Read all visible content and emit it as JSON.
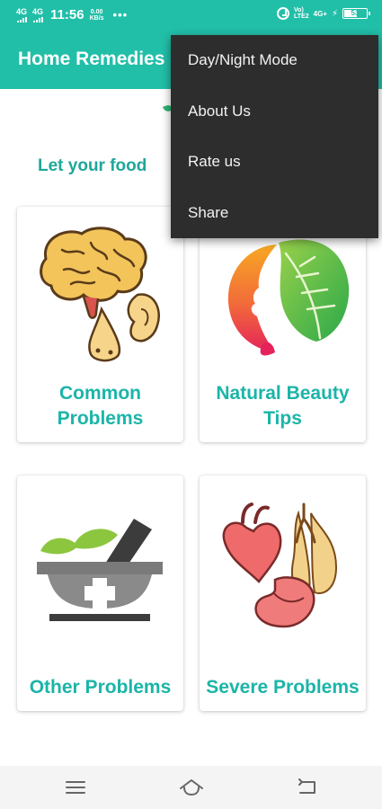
{
  "status_bar": {
    "signal1": "4G",
    "signal2": "4G",
    "time": "11:56",
    "speed_value": "0.00",
    "speed_unit": "KB/s",
    "volte_line1": "Vo)",
    "volte_line2": "LTE2",
    "net_type": "4G+",
    "battery": "53",
    "battery_level": 0.53,
    "icons": [
      "signal-icon",
      "alarm-icon",
      "charging-icon",
      "battery-icon"
    ]
  },
  "app_bar": {
    "title": "Home Remedies",
    "color": "#22bfa8"
  },
  "tagline": "Let your food",
  "cards": [
    {
      "label": "Common Problems",
      "icon": "brain-ear-nose-icon"
    },
    {
      "label": "Natural Beauty Tips",
      "icon": "face-leaf-icon"
    },
    {
      "label": "Other Problems",
      "icon": "mortar-pestle-icon"
    },
    {
      "label": "Severe Problems",
      "icon": "heart-lungs-stomach-icon"
    }
  ],
  "overflow_menu": {
    "items": [
      {
        "label": "Day/Night Mode"
      },
      {
        "label": "About Us"
      },
      {
        "label": "Rate us"
      },
      {
        "label": "Share"
      }
    ]
  },
  "nav_bar": {
    "icons": [
      "menu-icon",
      "home-icon",
      "back-icon"
    ]
  },
  "colors": {
    "accent": "#22bfa8",
    "card_label": "#1bb5a8",
    "menu_bg": "#2d2d2d"
  }
}
